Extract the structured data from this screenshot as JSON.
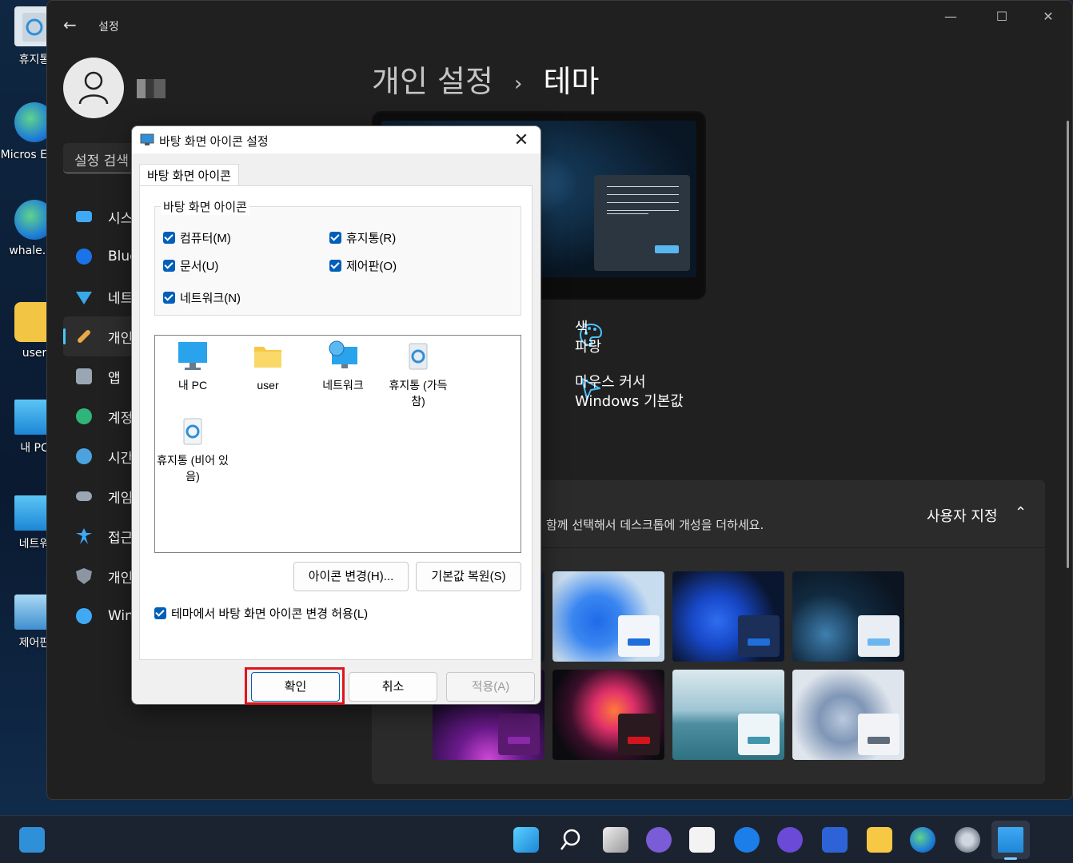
{
  "desktop": {
    "icons": [
      {
        "label": "휴지통",
        "name": "recycle-bin"
      },
      {
        "label": "Micros Edge",
        "name": "edge"
      },
      {
        "label": "whale.na",
        "name": "whale"
      },
      {
        "label": "user",
        "name": "user-folder"
      },
      {
        "label": "내 PC",
        "name": "this-pc"
      },
      {
        "label": "네트워",
        "name": "network"
      },
      {
        "label": "제어판",
        "name": "control-panel"
      }
    ]
  },
  "settings": {
    "app_title": "설정",
    "back_glyph": "←",
    "minimize_glyph": "—",
    "maximize_glyph": "☐",
    "close_glyph": "✕",
    "search_placeholder": "설정 검색",
    "nav": [
      {
        "label": "시스",
        "color": "#3fa9f5"
      },
      {
        "label": "Blue",
        "color": "#1a73e8"
      },
      {
        "label": "네트",
        "color": "#39a8e9"
      },
      {
        "label": "개인",
        "color": "#e8a948"
      },
      {
        "label": "앱",
        "color": "#9aa6b4"
      },
      {
        "label": "계정",
        "color": "#2fb57a"
      },
      {
        "label": "시간",
        "color": "#4aa3df"
      },
      {
        "label": "게임",
        "color": "#9aa6b4"
      },
      {
        "label": "접근",
        "color": "#3fa9f5"
      },
      {
        "label": "개인",
        "color": "#8c96a3"
      },
      {
        "label": "Win",
        "color": "#3fa9f5"
      }
    ],
    "breadcrumb_parent": "개인 설정",
    "breadcrumb_sep": "›",
    "page_title": "테마",
    "color_label": "색",
    "color_value": "파랑",
    "cursor_label": "마우스 커서",
    "cursor_value": "Windows 기본값",
    "customize_description": "함께 선택해서 데스크톱에 개성을 더하세요.",
    "customize_label": "사용자 지정",
    "chevron_glyph": "⌃",
    "accent_color": "#4cc2ff"
  },
  "dialog": {
    "title": "바탕 화면 아이콘 설정",
    "close_glyph": "✕",
    "tab": "바탕 화면 아이콘",
    "group_title": "바탕 화면 아이콘",
    "checkboxes": {
      "computer": "컴퓨터(M)",
      "recycle": "휴지통(R)",
      "documents": "문서(U)",
      "control_panel": "제어판(O)",
      "network": "네트워크(N)"
    },
    "icons": {
      "pc": "내 PC",
      "user": "user",
      "network": "네트워크",
      "recycle_full": "휴지통 (가득 참)",
      "recycle_empty": "휴지통 (비어 있음)"
    },
    "change_icon_button": "아이콘 변경(H)...",
    "restore_default_button": "기본값 복원(S)",
    "allow_themes_checkbox": "테마에서 바탕 화면 아이콘 변경 허용(L)",
    "ok_button": "확인",
    "cancel_button": "취소",
    "apply_button": "적용(A)"
  }
}
